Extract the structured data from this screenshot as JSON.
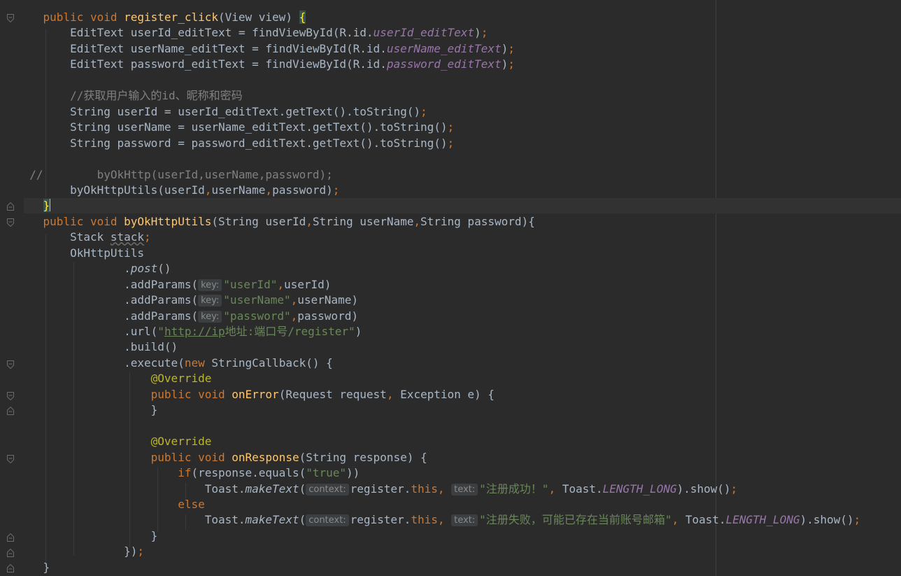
{
  "editor": {
    "lines": [
      {
        "indent": "    ",
        "parts": [
          {
            "t": "public void ",
            "c": "kw"
          },
          {
            "t": "register_click",
            "c": "fn"
          },
          {
            "t": "(View view) "
          },
          {
            "t": "{",
            "c": "brace-match"
          }
        ]
      },
      {
        "indent": "        ",
        "parts": [
          {
            "t": "EditText userId_editText = findViewById(R.id."
          },
          {
            "t": "userId_editText",
            "c": "field"
          },
          {
            "t": ")"
          },
          {
            "t": ";",
            "c": "kw"
          }
        ]
      },
      {
        "indent": "        ",
        "parts": [
          {
            "t": "EditText userName_editText = findViewById(R.id."
          },
          {
            "t": "userName_editText",
            "c": "field"
          },
          {
            "t": ")"
          },
          {
            "t": ";",
            "c": "kw"
          }
        ]
      },
      {
        "indent": "        ",
        "parts": [
          {
            "t": "EditText password_editText = findViewById(R.id."
          },
          {
            "t": "password_editText",
            "c": "field"
          },
          {
            "t": ")"
          },
          {
            "t": ";",
            "c": "kw"
          }
        ]
      },
      {
        "indent": "",
        "parts": []
      },
      {
        "indent": "        ",
        "parts": [
          {
            "t": "//获取用户输入的id、昵称和密码",
            "c": "cmt"
          }
        ]
      },
      {
        "indent": "        ",
        "parts": [
          {
            "t": "String userId = userId_editText.getText().toString()"
          },
          {
            "t": ";",
            "c": "kw"
          }
        ]
      },
      {
        "indent": "        ",
        "parts": [
          {
            "t": "String userName = userName_editText.getText().toString()"
          },
          {
            "t": ";",
            "c": "kw"
          }
        ]
      },
      {
        "indent": "        ",
        "parts": [
          {
            "t": "String password = password_editText.getText().toString()"
          },
          {
            "t": ";",
            "c": "kw"
          }
        ]
      },
      {
        "indent": "",
        "parts": []
      },
      {
        "indent": "  ",
        "parts": [
          {
            "t": "//        byOkHttp(userId,userName,password);",
            "c": "cmt"
          }
        ]
      },
      {
        "indent": "        ",
        "parts": [
          {
            "t": "byOkHttpUtils(userId"
          },
          {
            "t": ",",
            "c": "kw"
          },
          {
            "t": "userName"
          },
          {
            "t": ",",
            "c": "kw"
          },
          {
            "t": "password)"
          },
          {
            "t": ";",
            "c": "kw"
          }
        ]
      },
      {
        "indent": "    ",
        "parts": [
          {
            "t": "}",
            "c": "brace-match"
          },
          {
            "caret": true
          }
        ]
      },
      {
        "indent": "    ",
        "parts": [
          {
            "t": "public void ",
            "c": "kw"
          },
          {
            "t": "byOkHttpUtils",
            "c": "fn"
          },
          {
            "t": "(String userId"
          },
          {
            "t": ",",
            "c": "kw"
          },
          {
            "t": "String userName"
          },
          {
            "t": ",",
            "c": "kw"
          },
          {
            "t": "String password){"
          }
        ]
      },
      {
        "indent": "        ",
        "parts": [
          {
            "t": "Stack "
          },
          {
            "t": "stack",
            "c": "unused"
          },
          {
            "t": ";",
            "c": "kw"
          }
        ]
      },
      {
        "indent": "        ",
        "parts": [
          {
            "t": "OkHttpUtils"
          }
        ]
      },
      {
        "indent": "                ",
        "parts": [
          {
            "t": "."
          },
          {
            "t": "post",
            "c": "it"
          },
          {
            "t": "()"
          }
        ]
      },
      {
        "indent": "                ",
        "parts": [
          {
            "t": ".addParams("
          },
          {
            "hint": "key:"
          },
          {
            "t": "\"userId\"",
            "c": "str"
          },
          {
            "t": ",",
            "c": "kw"
          },
          {
            "t": "userId)"
          }
        ]
      },
      {
        "indent": "                ",
        "parts": [
          {
            "t": ".addParams("
          },
          {
            "hint": "key:"
          },
          {
            "t": "\"userName\"",
            "c": "str"
          },
          {
            "t": ",",
            "c": "kw"
          },
          {
            "t": "userName)"
          }
        ]
      },
      {
        "indent": "                ",
        "parts": [
          {
            "t": ".addParams("
          },
          {
            "hint": "key:"
          },
          {
            "t": "\"password\"",
            "c": "str"
          },
          {
            "t": ",",
            "c": "kw"
          },
          {
            "t": "password)"
          }
        ]
      },
      {
        "indent": "                ",
        "parts": [
          {
            "t": ".url("
          },
          {
            "t": "\"",
            "c": "str"
          },
          {
            "t": "http://ip",
            "c": "url"
          },
          {
            "t": "地址:端口号/register\"",
            "c": "str"
          },
          {
            "t": ")"
          }
        ]
      },
      {
        "indent": "                ",
        "parts": [
          {
            "t": ".build()"
          }
        ]
      },
      {
        "indent": "                ",
        "parts": [
          {
            "t": ".execute("
          },
          {
            "t": "new ",
            "c": "kw"
          },
          {
            "t": "StringCallback() {"
          }
        ]
      },
      {
        "indent": "                    ",
        "parts": [
          {
            "t": "@Override",
            "c": "ann"
          }
        ]
      },
      {
        "indent": "                    ",
        "parts": [
          {
            "t": "public void ",
            "c": "kw"
          },
          {
            "t": "onError",
            "c": "fn"
          },
          {
            "t": "(Request request"
          },
          {
            "t": ", ",
            "c": "kw"
          },
          {
            "t": "Exception e) {"
          }
        ]
      },
      {
        "indent": "                    ",
        "parts": [
          {
            "t": "}"
          }
        ]
      },
      {
        "indent": "",
        "parts": []
      },
      {
        "indent": "                    ",
        "parts": [
          {
            "t": "@Override",
            "c": "ann"
          }
        ]
      },
      {
        "indent": "                    ",
        "parts": [
          {
            "t": "public void ",
            "c": "kw"
          },
          {
            "t": "onResponse",
            "c": "fn"
          },
          {
            "t": "(String response) {"
          }
        ]
      },
      {
        "indent": "                        ",
        "parts": [
          {
            "t": "if",
            "c": "kw"
          },
          {
            "t": "(response.equals("
          },
          {
            "t": "\"true\"",
            "c": "str"
          },
          {
            "t": "))"
          }
        ]
      },
      {
        "indent": "                            ",
        "parts": [
          {
            "t": "Toast."
          },
          {
            "t": "makeText",
            "c": "it"
          },
          {
            "t": "("
          },
          {
            "hint": "context:"
          },
          {
            "t": "register."
          },
          {
            "t": "this",
            "c": "kw"
          },
          {
            "t": ", ",
            "c": "kw"
          },
          {
            "hint": "text:"
          },
          {
            "t": "\"注册成功！\"",
            "c": "str"
          },
          {
            "t": ", ",
            "c": "kw"
          },
          {
            "t": "Toast."
          },
          {
            "t": "LENGTH_LONG",
            "c": "static"
          },
          {
            "t": ").show()"
          },
          {
            "t": ";",
            "c": "kw"
          }
        ]
      },
      {
        "indent": "                        ",
        "parts": [
          {
            "t": "else",
            "c": "kw"
          }
        ]
      },
      {
        "indent": "                            ",
        "parts": [
          {
            "t": "Toast."
          },
          {
            "t": "makeText",
            "c": "it"
          },
          {
            "t": "("
          },
          {
            "hint": "context:"
          },
          {
            "t": "register."
          },
          {
            "t": "this",
            "c": "kw"
          },
          {
            "t": ", ",
            "c": "kw"
          },
          {
            "hint": "text:"
          },
          {
            "t": "\"注册失败，可能已存在当前账号邮箱\"",
            "c": "str"
          },
          {
            "t": ", ",
            "c": "kw"
          },
          {
            "t": "Toast."
          },
          {
            "t": "LENGTH_LONG",
            "c": "static"
          },
          {
            "t": ").show()"
          },
          {
            "t": ";",
            "c": "kw"
          }
        ]
      },
      {
        "indent": "                    ",
        "parts": [
          {
            "t": "}"
          }
        ]
      },
      {
        "indent": "                ",
        "parts": [
          {
            "t": "})"
          },
          {
            "t": ";",
            "c": "kw"
          }
        ]
      },
      {
        "indent": "    ",
        "parts": [
          {
            "t": "}"
          }
        ]
      }
    ]
  }
}
